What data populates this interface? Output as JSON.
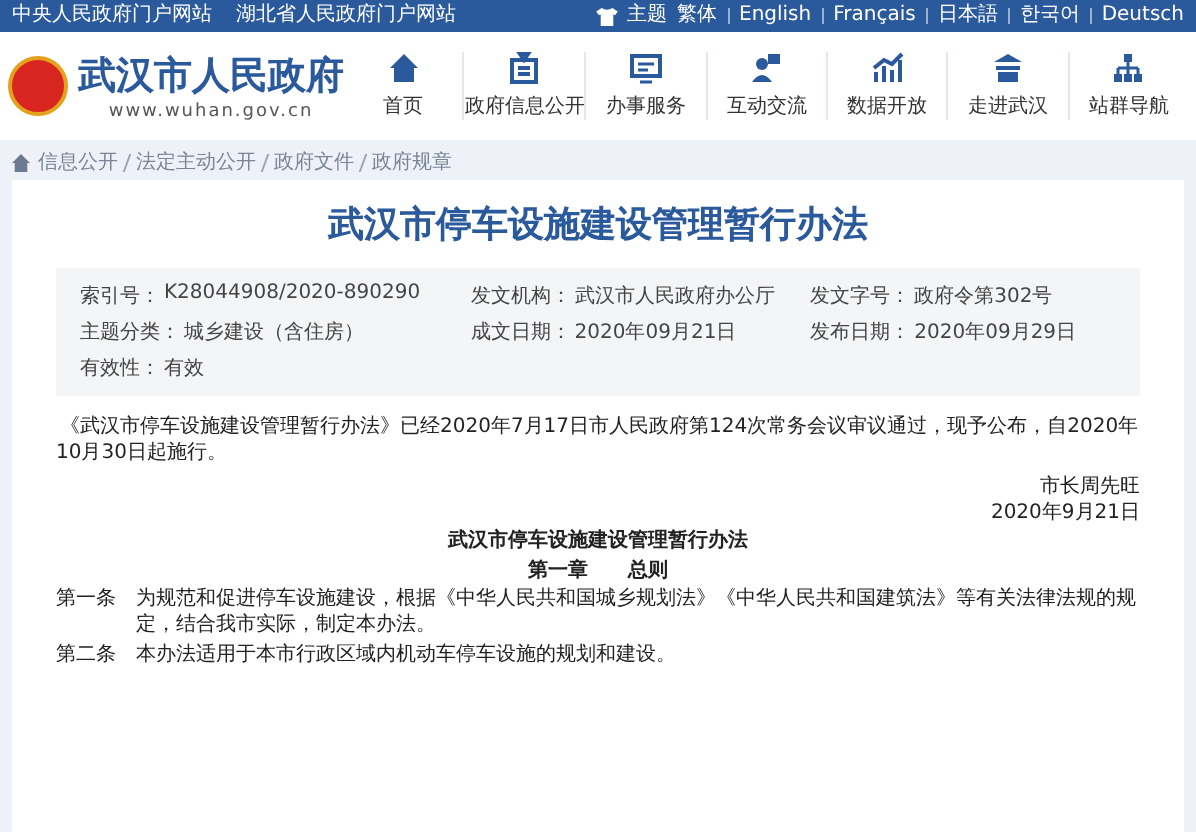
{
  "top_bar": {
    "links": [
      "中央人民政府门户网站",
      "湖北省人民政府门户网站"
    ],
    "theme": "主题",
    "languages": [
      "繁体",
      "English",
      "Français",
      "日本語",
      "한국어",
      "Deutsch"
    ]
  },
  "header": {
    "site_name": "武汉市人民政府",
    "domain": "www.wuhan.gov.cn",
    "nav": [
      {
        "label": "首页",
        "kind": "home"
      },
      {
        "label": "政府信息公开",
        "kind": "info"
      },
      {
        "label": "办事服务",
        "kind": "service"
      },
      {
        "label": "互动交流",
        "kind": "chat"
      },
      {
        "label": "数据开放",
        "kind": "data"
      },
      {
        "label": "走进武汉",
        "kind": "city"
      },
      {
        "label": "站群导航",
        "kind": "sitemap"
      }
    ]
  },
  "breadcrumb": [
    "信息公开",
    "法定主动公开",
    "政府文件",
    "政府规章"
  ],
  "document": {
    "title": "武汉市停车设施建设管理暂行办法",
    "meta": [
      {
        "label": "索引号：",
        "value": "K28044908/2020-890290"
      },
      {
        "label": "发文机构：",
        "value": "武汉市人民政府办公厅"
      },
      {
        "label": "发文字号：",
        "value": "政府令第302号"
      },
      {
        "label": "主题分类：",
        "value": "城乡建设（含住房）"
      },
      {
        "label": "成文日期：",
        "value": "2020年09月21日"
      },
      {
        "label": "发布日期：",
        "value": "2020年09月29日"
      },
      {
        "label": "有效性：",
        "value": "有效"
      }
    ],
    "intro": "《武汉市停车设施建设管理暂行办法》已经2020年7月17日市人民政府第124次常务会议审议通过，现予公布，自2020年10月30日起施行。",
    "signer": "市长周先旺",
    "date": "2020年9月21日",
    "body_title": "武汉市停车设施建设管理暂行办法",
    "chapter": "第一章　　总则",
    "articles": [
      {
        "number": "第一条",
        "text": "为规范和促进停车设施建设，根据《中华人民共和国城乡规划法》《中华人民共和国建筑法》等有关法律法规的规定，结合我市实际，制定本办法。"
      },
      {
        "number": "第二条",
        "text": "本办法适用于本市行政区域内机动车停车设施的规划和建设。"
      }
    ]
  }
}
